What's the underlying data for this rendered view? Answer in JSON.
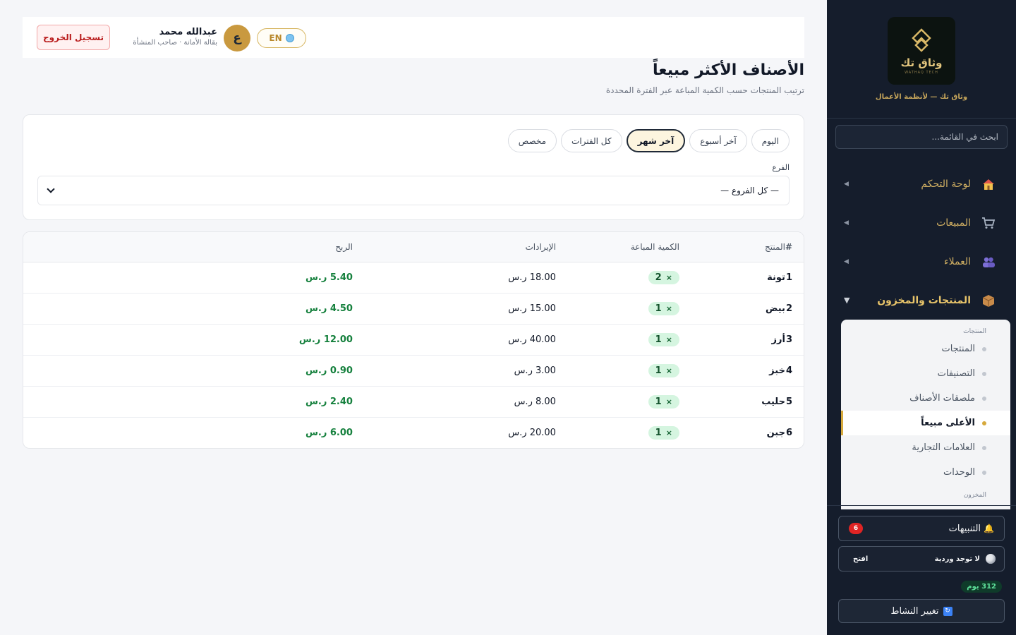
{
  "topbar": {
    "lang_label": "EN",
    "avatar_initial": "ع",
    "user_name": "عبدالله محمد",
    "user_role": "بقالة الأمانة · صاحب المنشأة",
    "logout_label": "تسجيل الخروج"
  },
  "page": {
    "title": "الأصناف الأكثر مبيعاً",
    "subtitle": "ترتيب المنتجات حسب الكمية المباعة عبر الفترة المحددة"
  },
  "filters": {
    "periods": [
      "اليوم",
      "آخر أسبوع",
      "آخر شهر",
      "كل الفترات",
      "مخصص"
    ],
    "active_period": "آخر شهر",
    "branch_label": "الفرع",
    "branch_value": "— كل الفروع —"
  },
  "table": {
    "headers": {
      "num": "#",
      "product": "المنتج",
      "qty": "الكمية المباعة",
      "revenue": "الإيرادات",
      "profit": "الربح"
    },
    "rows": [
      {
        "rank": "1",
        "product": "تونة",
        "qty": "2",
        "revenue": "18.00 ر.س",
        "profit": "5.40 ر.س"
      },
      {
        "rank": "2",
        "product": "بيض",
        "qty": "1",
        "revenue": "15.00 ر.س",
        "profit": "4.50 ر.س"
      },
      {
        "rank": "3",
        "product": "أرز",
        "qty": "1",
        "revenue": "40.00 ر.س",
        "profit": "12.00 ر.س"
      },
      {
        "rank": "4",
        "product": "خبز",
        "qty": "1",
        "revenue": "3.00 ر.س",
        "profit": "0.90 ر.س"
      },
      {
        "rank": "5",
        "product": "حليب",
        "qty": "1",
        "revenue": "8.00 ر.س",
        "profit": "2.40 ر.س"
      },
      {
        "rank": "6",
        "product": "جبن",
        "qty": "1",
        "revenue": "20.00 ر.س",
        "profit": "6.00 ر.س"
      }
    ]
  },
  "sidebar": {
    "logo_name": "وثاق تك",
    "logo_sub": "WATHAQ TECH",
    "tagline": "وثاق تك — لأنظمة الأعمال",
    "search_placeholder": "ابحث في القائمة...",
    "nav": [
      {
        "label": "لوحة التحكم",
        "icon": "home-icon"
      },
      {
        "label": "المبيعات",
        "icon": "cart-icon"
      },
      {
        "label": "العملاء",
        "icon": "users-icon"
      },
      {
        "label": "المنتجات والمخزون",
        "icon": "box-icon"
      }
    ],
    "submenu_group_products": "المنتجات",
    "submenu_items": [
      "المنتجات",
      "التصنيفات",
      "ملصقات الأصناف",
      "الأعلى مبيعاً",
      "العلامات التجارية",
      "الوحدات"
    ],
    "submenu_group_inventory": "المخزون",
    "alerts_label": "التنبيهات",
    "alerts_count": "6",
    "shift_label": "لا توجد وردية",
    "shift_open": "افتح",
    "days_left": "312 يوم",
    "switch_label": "تغيير النشاط",
    "colors": {
      "bg": "#151d2c",
      "accent": "#d6a93c"
    }
  }
}
